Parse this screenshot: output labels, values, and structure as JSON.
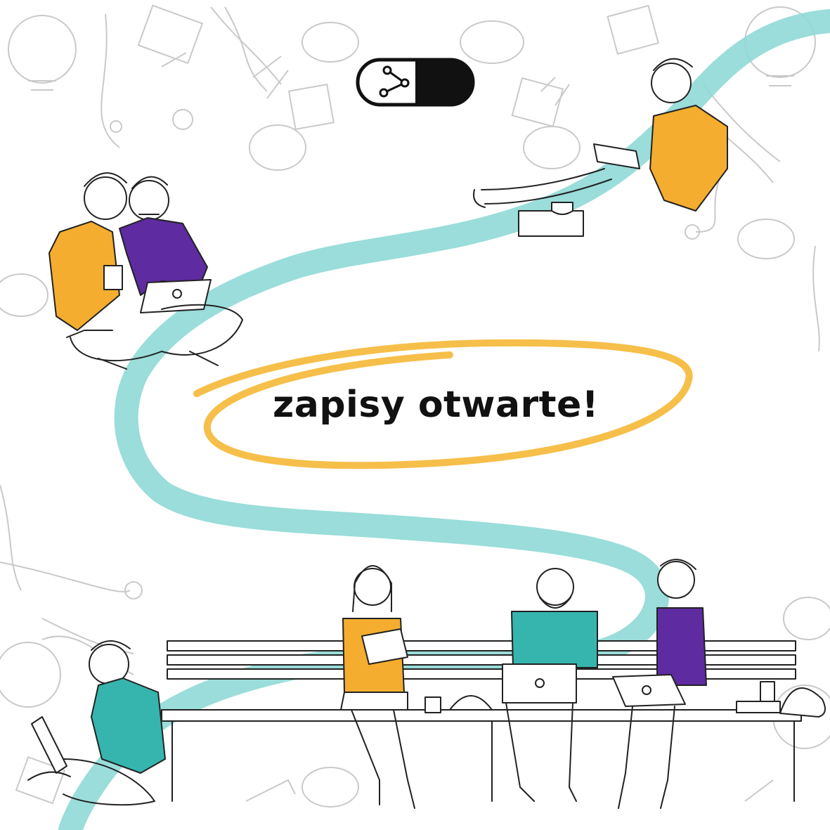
{
  "headline": "zapisy otwarte!",
  "logo": {
    "icon": "pill-share-logo-icon"
  },
  "colors": {
    "accent_teal": "#8fd9d6",
    "accent_yellow": "#f6bf4a",
    "shirt_orange": "#f4ad2f",
    "shirt_purple": "#5e2ba0",
    "shirt_teal": "#36b5ae",
    "doodle_gray": "#c9c9c9",
    "ink": "#111111"
  },
  "illustration": {
    "people": [
      "couple-with-laptop",
      "man-reading-book",
      "man-with-laptop-sitting",
      "woman-with-tablet-on-bench",
      "man-with-laptop-on-bench",
      "woman-with-laptop-on-bench"
    ]
  }
}
